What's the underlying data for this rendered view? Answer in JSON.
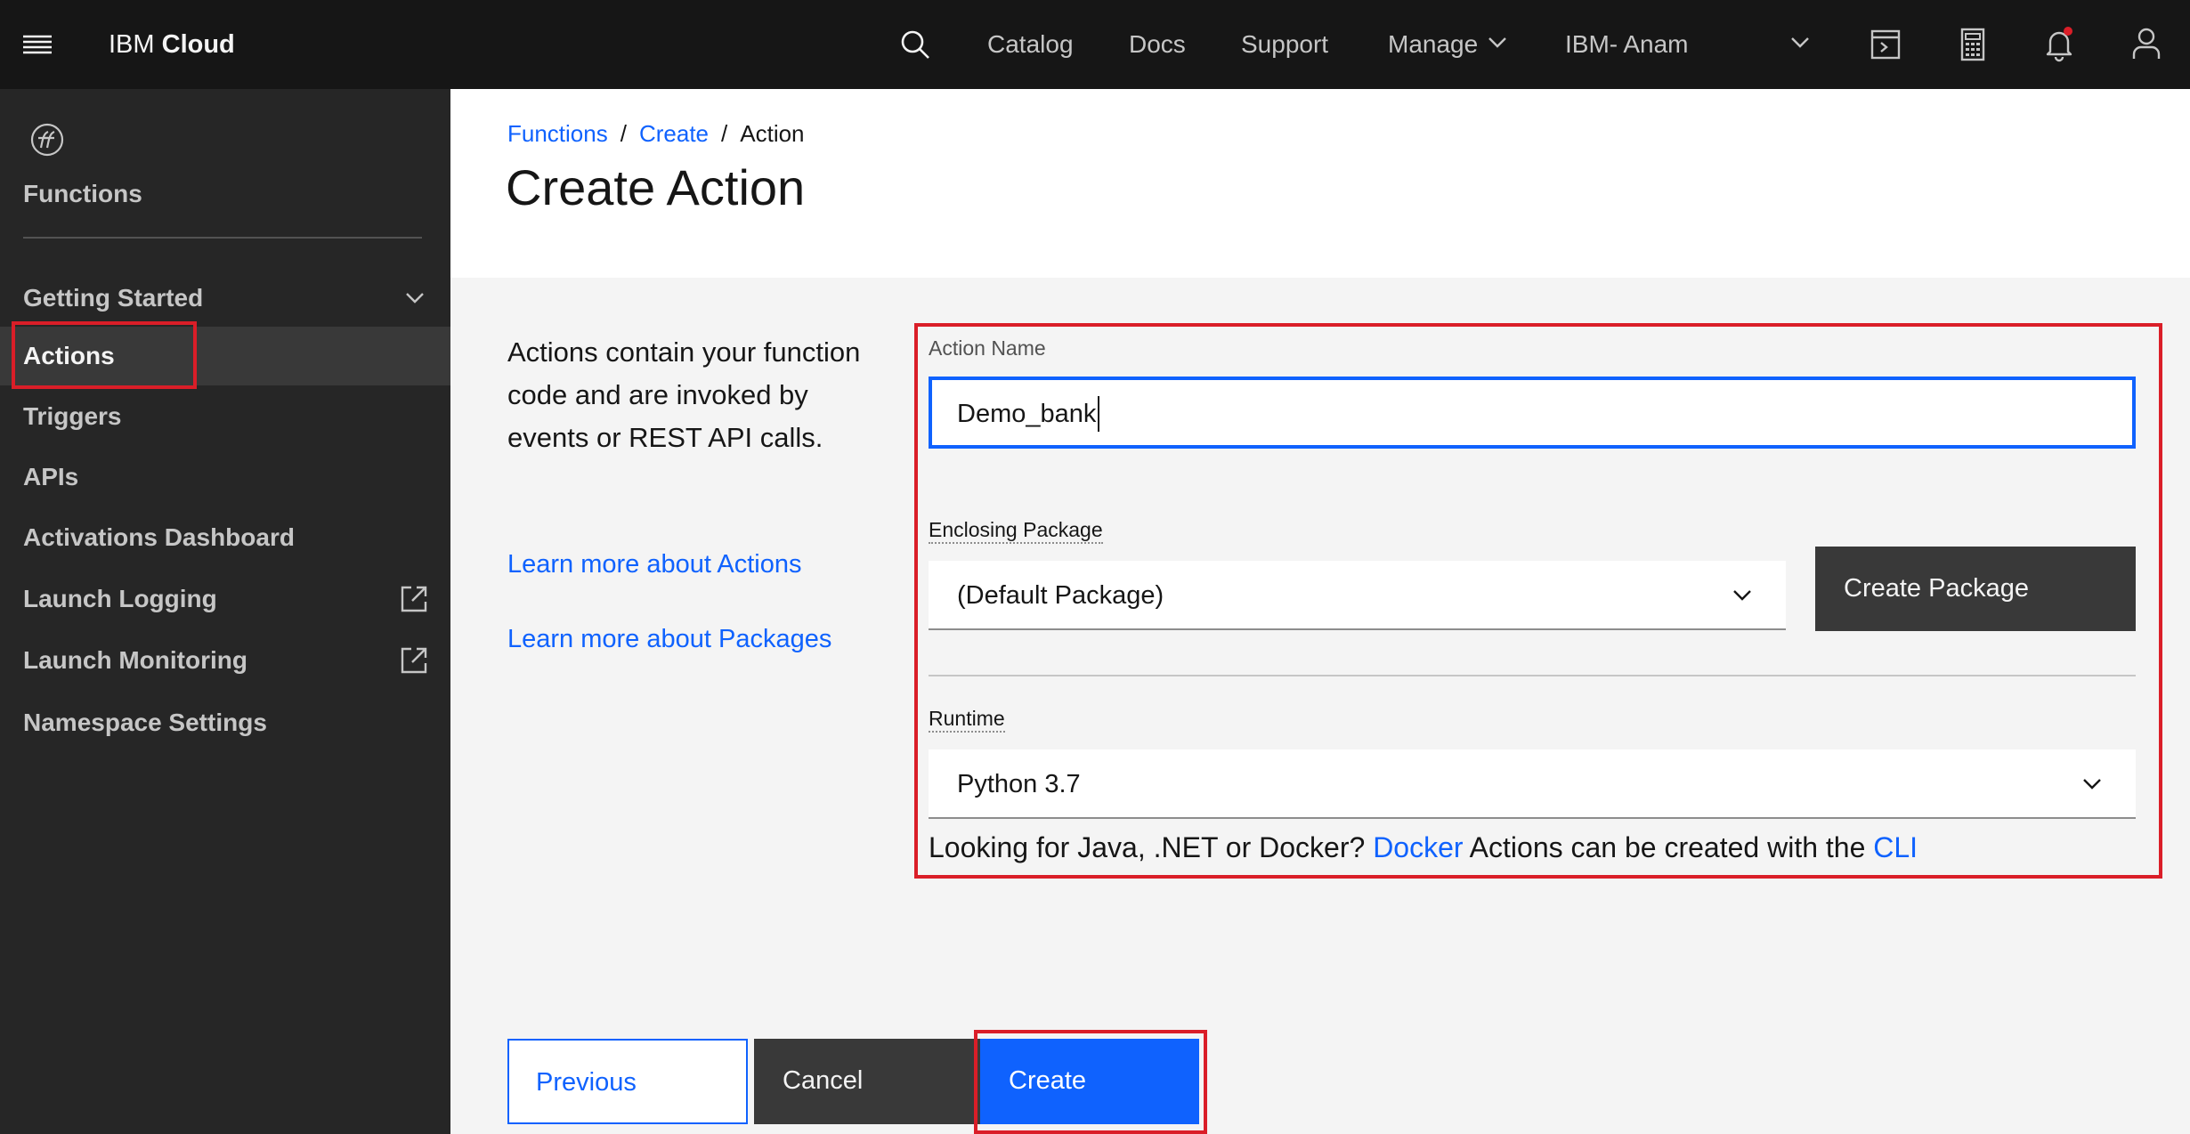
{
  "topbar": {
    "brand_prefix": "IBM",
    "brand_bold": "Cloud",
    "nav": [
      "Catalog",
      "Docs",
      "Support",
      "Manage"
    ],
    "account": "IBM- Anam",
    "icons": [
      "menu-icon",
      "search-icon",
      "chevron-down-icon",
      "terminal-icon",
      "calculator-icon",
      "notification-icon",
      "user-icon"
    ],
    "notification_color": "#da1e28"
  },
  "sidebar": {
    "title": "Functions",
    "items": [
      {
        "label": "Getting Started",
        "icon": "chevron-down-icon"
      },
      {
        "label": "Actions",
        "active": true
      },
      {
        "label": "Triggers"
      },
      {
        "label": "APIs"
      },
      {
        "label": "Activations Dashboard"
      },
      {
        "label": "Launch Logging",
        "icon": "launch-icon"
      },
      {
        "label": "Launch Monitoring",
        "icon": "launch-icon"
      },
      {
        "label": "Namespace Settings"
      }
    ]
  },
  "header": {
    "breadcrumb": [
      "Functions",
      "Create",
      "Action"
    ],
    "title": "Create Action"
  },
  "info": {
    "description": "Actions contain your function code and are invoked by events or REST API calls.",
    "learn_actions": "Learn more about Actions",
    "learn_packages": "Learn more about Packages"
  },
  "form": {
    "action_name_label": "Action Name",
    "action_name_value": "Demo_bank",
    "package_label": "Enclosing Package",
    "package_value": "(Default Package)",
    "create_package_button": "Create Package",
    "runtime_label": "Runtime",
    "runtime_value": "Python 3.7",
    "hint_prefix": "Looking for Java, .NET or Docker?",
    "hint_docker": "Docker",
    "hint_middle": "Actions can be created with the",
    "hint_cli": "CLI"
  },
  "footer": {
    "previous": "Previous",
    "cancel": "Cancel",
    "create": "Create"
  },
  "colors": {
    "accent": "#0f62fe",
    "highlight": "#da1e28",
    "topbar": "#161616",
    "sidebar": "#262626"
  }
}
